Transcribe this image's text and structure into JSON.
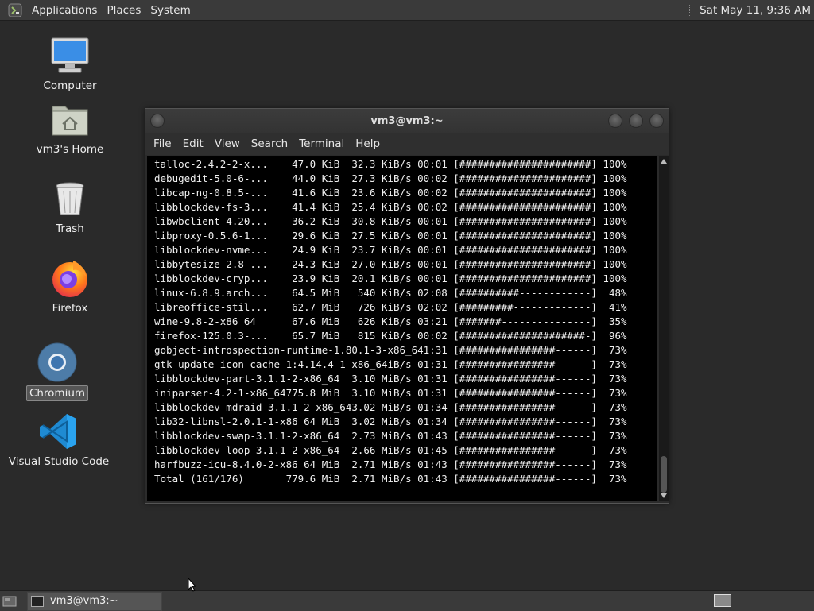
{
  "top_panel": {
    "menus": [
      "Applications",
      "Places",
      "System"
    ],
    "clock": "Sat May 11,  9:36 AM"
  },
  "desktop_icons": [
    {
      "label": "Computer",
      "icon": "computer-icon"
    },
    {
      "label": "vm3's Home",
      "icon": "home-folder-icon"
    },
    {
      "label": "Trash",
      "icon": "trash-icon"
    },
    {
      "label": "Firefox",
      "icon": "firefox-icon"
    },
    {
      "label": "Chromium",
      "icon": "chromium-icon",
      "selected": true
    },
    {
      "label": "Visual Studio Code",
      "icon": "vscode-icon"
    }
  ],
  "terminal": {
    "title": "vm3@vm3:~",
    "menu": [
      "File",
      "Edit",
      "View",
      "Search",
      "Terminal",
      "Help"
    ],
    "lines": [
      "talloc-2.4.2-2-x...    47.0 KiB  32.3 KiB/s 00:01 [######################] 100%",
      "debugedit-5.0-6-...    44.0 KiB  27.3 KiB/s 00:02 [######################] 100%",
      "libcap-ng-0.8.5-...    41.6 KiB  23.6 KiB/s 00:02 [######################] 100%",
      "libblockdev-fs-3...    41.4 KiB  25.4 KiB/s 00:02 [######################] 100%",
      "libwbclient-4.20...    36.2 KiB  30.8 KiB/s 00:01 [######################] 100%",
      "libproxy-0.5.6-1...    29.6 KiB  27.5 KiB/s 00:01 [######################] 100%",
      "libblockdev-nvme...    24.9 KiB  23.7 KiB/s 00:01 [######################] 100%",
      "libbytesize-2.8-...    24.3 KiB  27.0 KiB/s 00:01 [######################] 100%",
      "libblockdev-cryp...    23.9 KiB  20.1 KiB/s 00:01 [######################] 100%",
      "linux-6.8.9.arch...    64.5 MiB   540 KiB/s 02:08 [##########------------]  48%",
      "libreoffice-stil...    62.7 MiB   726 KiB/s 02:02 [#########-------------]  41%",
      "wine-9.8-2-x86_64      67.6 MiB   626 KiB/s 03:21 [#######---------------]  35%",
      "firefox-125.0.3-...    65.7 MiB   815 KiB/s 00:02 [#####################-]  96%",
      "gobject-introspection-runtime-1.80.1-3-x86_641:31 [################------]  73%",
      "gtk-update-icon-cache-1:4.14.4-1-x86_64iB/s 01:31 [################------]  73%",
      "libblockdev-part-3.1.1-2-x86_64  3.10 MiB/s 01:31 [################------]  73%",
      "iniparser-4.2-1-x86_64775.8 MiB  3.10 MiB/s 01:31 [################------]  73%",
      "libblockdev-mdraid-3.1.1-2-x86_643.02 MiB/s 01:34 [################------]  73%",
      "lib32-libnsl-2.0.1-1-x86_64 MiB  3.02 MiB/s 01:34 [################------]  73%",
      "libblockdev-swap-3.1.1-2-x86_64  2.73 MiB/s 01:43 [################------]  73%",
      "libblockdev-loop-3.1.1-2-x86_64  2.66 MiB/s 01:45 [################------]  73%",
      "harfbuzz-icu-8.4.0-2-x86_64 MiB  2.71 MiB/s 01:43 [################------]  73%",
      "Total (161/176)       779.6 MiB  2.71 MiB/s 01:43 [################------]  73%"
    ]
  },
  "taskbar": {
    "tasks": [
      {
        "label": "vm3@vm3:~",
        "icon": "terminal-icon"
      }
    ]
  }
}
